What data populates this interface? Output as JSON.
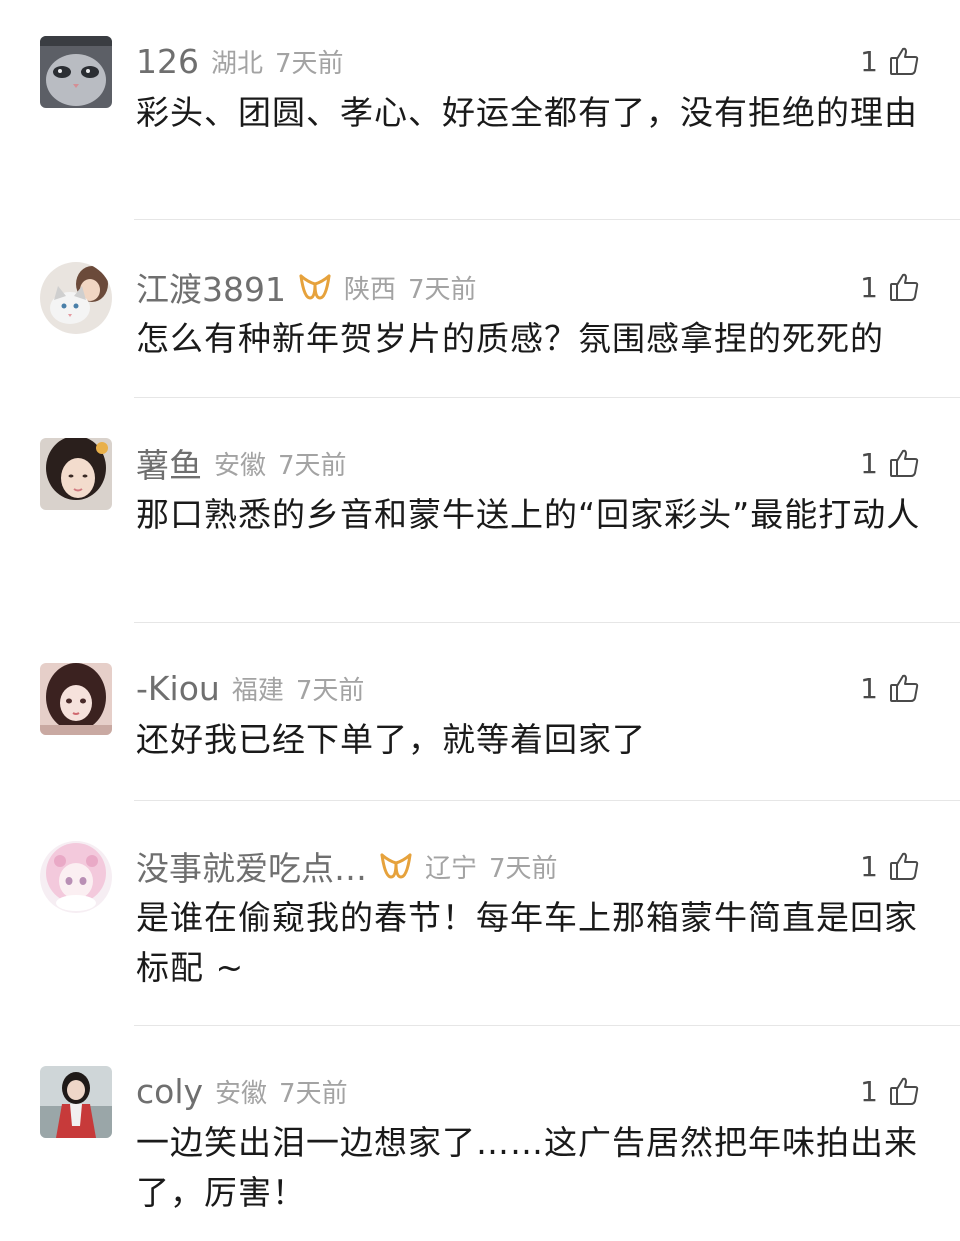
{
  "comments": [
    {
      "username": "126",
      "location": "湖北",
      "time": "7天前",
      "likes": "1",
      "text": "彩头、团圆、孝心、好运全都有了，没有拒绝的理由",
      "avatar": "cat-avatar",
      "badge": false
    },
    {
      "username": "江渡3891",
      "location": "陕西",
      "time": "7天前",
      "likes": "1",
      "text": "怎么有种新年贺岁片的质感？氛围感拿捏的死死的",
      "avatar": "cat-girl-avatar",
      "badge": true
    },
    {
      "username": "薯鱼",
      "location": "安徽",
      "time": "7天前",
      "likes": "1",
      "text": "那口熟悉的乡音和蒙牛送上的“回家彩头”最能打动人",
      "avatar": "girl-avatar",
      "badge": false
    },
    {
      "username": "-Kiou",
      "location": "福建",
      "time": "7天前",
      "likes": "1",
      "text": "还好我已经下单了，就等着回家了",
      "avatar": "anime-girl-avatar",
      "badge": false
    },
    {
      "username": "没事就爱吃点…",
      "location": "辽宁",
      "time": "7天前",
      "likes": "1",
      "text": "是谁在偷窥我的春节！每年车上那箱蒙牛简直是回家标配 ~",
      "avatar": "pink-anime-avatar",
      "badge": true
    },
    {
      "username": "coly",
      "location": "安徽",
      "time": "7天前",
      "likes": "1",
      "text": "一边笑出泪一边想家了……这广告居然把年味拍出来了，厉害！",
      "avatar": "girl-red-avatar",
      "badge": false
    }
  ],
  "colors": {
    "username": "#6f6f6f",
    "meta": "#a3a3a3",
    "text": "#1a1a1a",
    "badge": "#e6a23c",
    "divider": "#e6e6e6"
  }
}
